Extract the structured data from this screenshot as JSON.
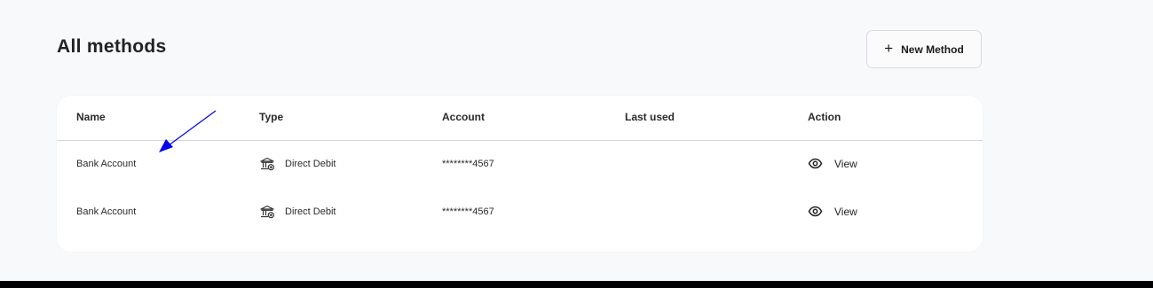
{
  "header": {
    "title": "All methods",
    "new_button_label": "New Method",
    "new_button_icon": "plus-icon"
  },
  "table": {
    "columns": [
      "Name",
      "Type",
      "Account",
      "Last used",
      "Action"
    ],
    "rows": [
      {
        "name": "Bank Account",
        "type": "Direct Debit",
        "type_icon": "bank-icon",
        "account": "********4567",
        "last_used": "",
        "action": "View",
        "action_icon": "eye-icon"
      },
      {
        "name": "Bank Account",
        "type": "Direct Debit",
        "type_icon": "bank-icon",
        "account": "********4567",
        "last_used": "",
        "action": "View",
        "action_icon": "eye-icon"
      }
    ]
  },
  "annotation": {
    "arrow_color": "#0000ee"
  },
  "colors": {
    "page_bg": "#f8f9fb",
    "card_bg": "#ffffff",
    "text": "#222222",
    "divider": "#d4d6da"
  }
}
